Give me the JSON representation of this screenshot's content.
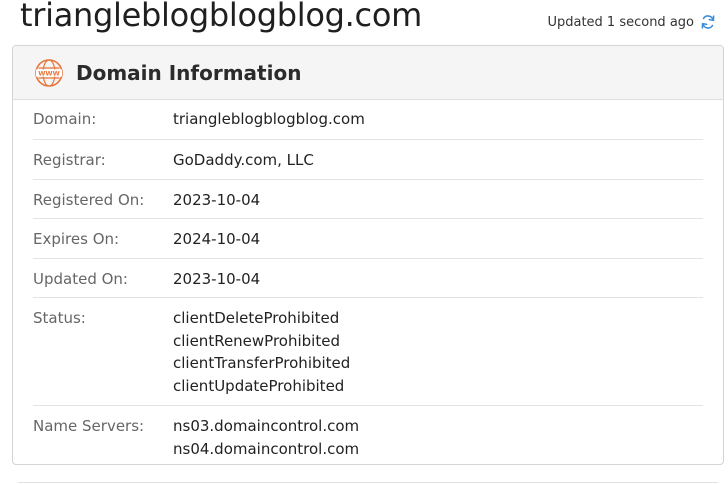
{
  "header": {
    "site_title": "triangleblogblogblog.com",
    "updated_text": "Updated 1 second ago",
    "refresh_icon": "refresh-icon"
  },
  "panel": {
    "title": "Domain Information",
    "icon": "www-icon",
    "rows": [
      {
        "label": "Domain:",
        "values": [
          "triangleblogblogblog.com"
        ]
      },
      {
        "label": "Registrar:",
        "values": [
          "GoDaddy.com, LLC"
        ]
      },
      {
        "label": "Registered On:",
        "values": [
          "2023-10-04"
        ]
      },
      {
        "label": "Expires On:",
        "values": [
          "2024-10-04"
        ]
      },
      {
        "label": "Updated On:",
        "values": [
          "2023-10-04"
        ]
      },
      {
        "label": "Status:",
        "values": [
          "clientDeleteProhibited",
          "clientRenewProhibited",
          "clientTransferProhibited",
          "clientUpdateProhibited"
        ]
      },
      {
        "label": "Name Servers:",
        "values": [
          "ns03.domaincontrol.com",
          "ns04.domaincontrol.com"
        ]
      }
    ]
  },
  "colors": {
    "accent_orange": "#e8753a",
    "refresh_blue": "#3b8fd9"
  }
}
